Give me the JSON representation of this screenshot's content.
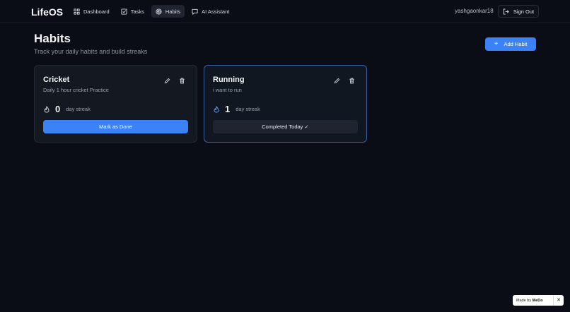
{
  "app": {
    "name": "LifeOS"
  },
  "nav": {
    "items": [
      {
        "label": "Dashboard",
        "icon": "dashboard-icon"
      },
      {
        "label": "Tasks",
        "icon": "checkbox-icon"
      },
      {
        "label": "Habits",
        "icon": "target-icon"
      },
      {
        "label": "AI Assistant",
        "icon": "chat-icon"
      }
    ],
    "active": "Habits"
  },
  "user": {
    "username": "yashgaonkar18",
    "signout_label": "Sign Out"
  },
  "page": {
    "title": "Habits",
    "subtitle": "Track your daily habits and build streaks",
    "add_label": "Add Habit"
  },
  "habits": [
    {
      "title": "Cricket",
      "description": "Daily 1 hour cricket Practice",
      "streak": "0",
      "streak_label": "day streak",
      "button_label": "Mark as Done",
      "completed": false
    },
    {
      "title": "Running",
      "description": "i want to run",
      "streak": "1",
      "streak_label": "day streak",
      "button_label": "Completed Today ✓",
      "completed": true
    }
  ],
  "badge": {
    "prefix": "Made by",
    "brand": "MeDo",
    "close": "✕"
  },
  "colors": {
    "accent": "#3b82f6",
    "background": "#0a0d16",
    "card": "#141821"
  }
}
